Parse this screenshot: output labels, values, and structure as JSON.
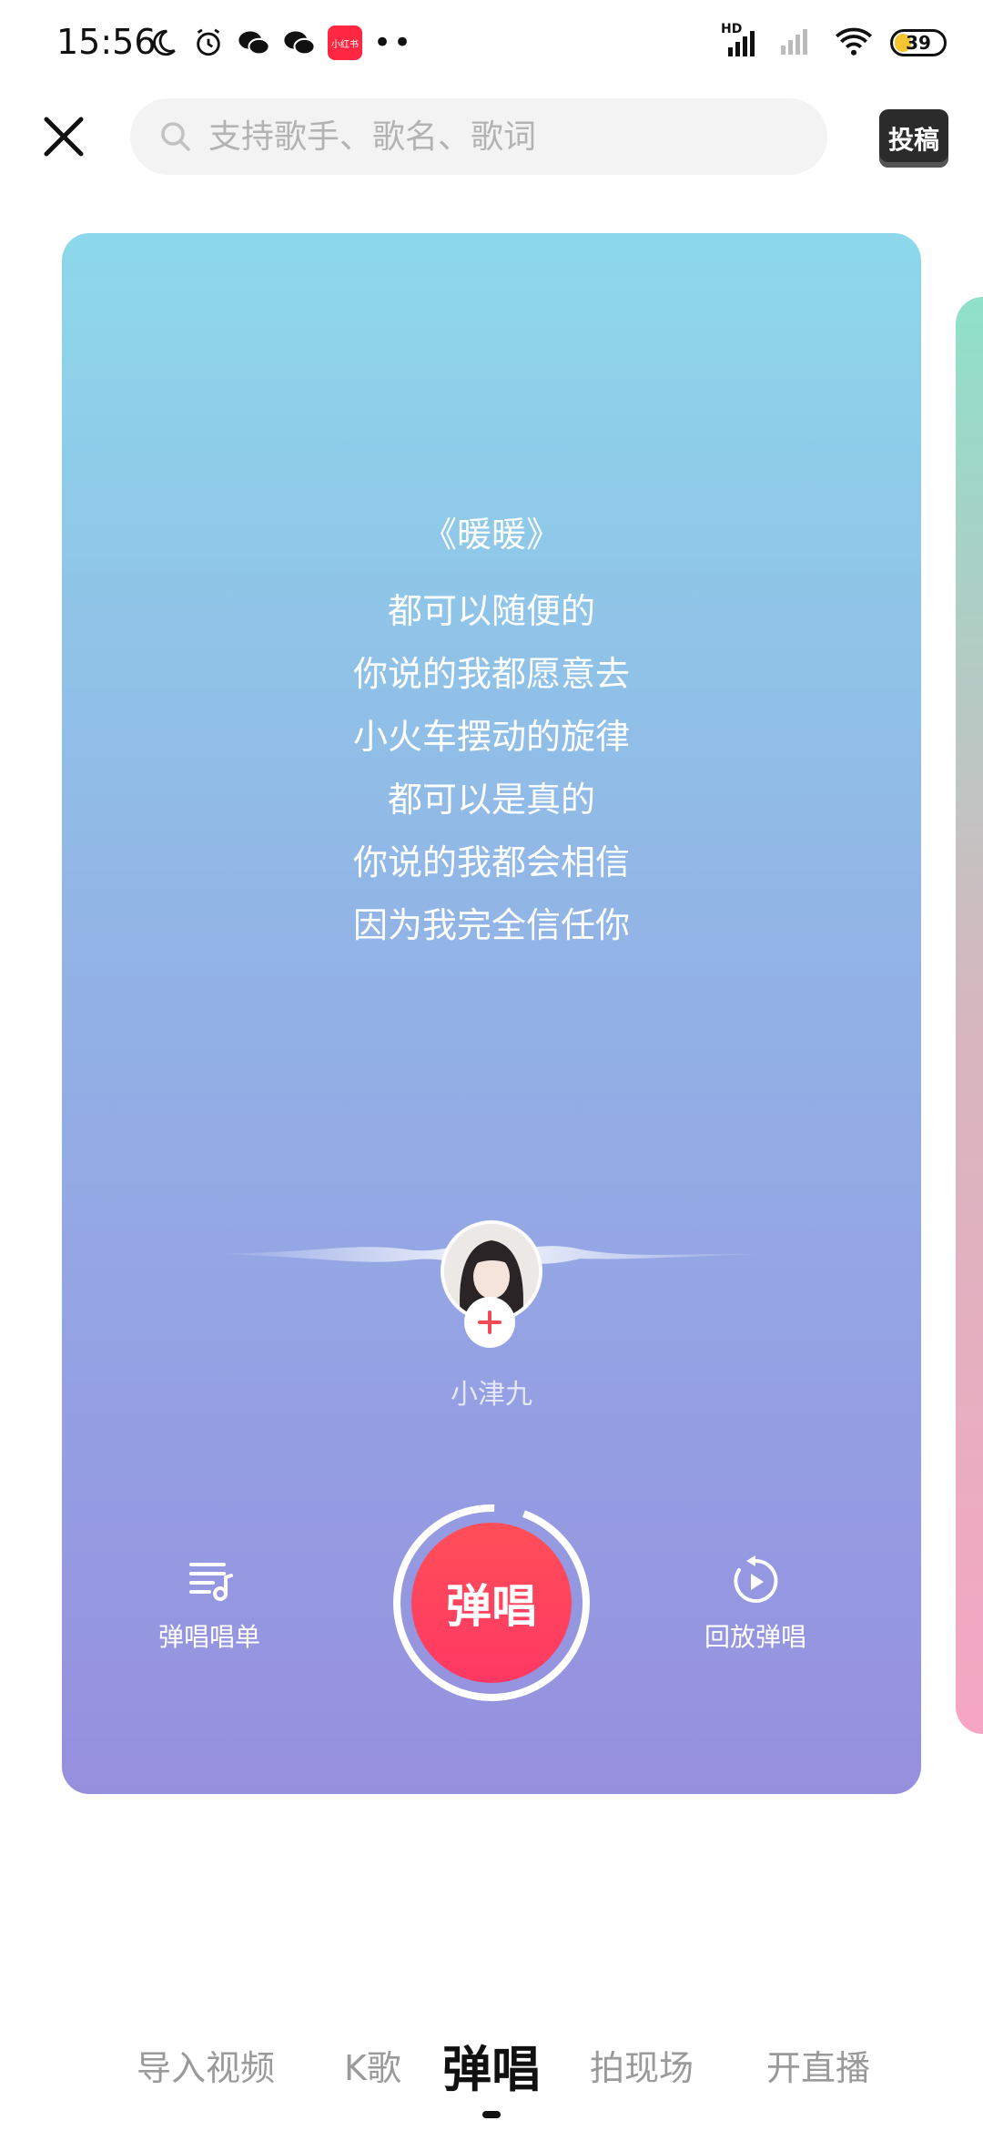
{
  "status_bar": {
    "time": "15:56",
    "app_badge": "小红书",
    "dots": "••",
    "network_label": "HD",
    "battery": "39"
  },
  "search": {
    "placeholder": "支持歌手、歌名、歌词"
  },
  "header": {
    "submit_label": "投稿"
  },
  "card": {
    "song_title": "《暖暖》",
    "lyrics": [
      "都可以随便的",
      "你说的我都愿意去",
      "小火车摆动的旋律",
      "都可以是真的",
      "你说的我都会相信",
      "因为我完全信任你"
    ],
    "username": "小津九",
    "left_tool_label": "弹唱唱单",
    "right_tool_label": "回放弹唱",
    "main_button_label": "弹唱"
  },
  "tabs": [
    {
      "label": "导入视频",
      "active": false
    },
    {
      "label": "K歌",
      "active": false
    },
    {
      "label": "弹唱",
      "active": true
    },
    {
      "label": "拍现场",
      "active": false
    },
    {
      "label": "开直播",
      "active": false
    }
  ],
  "colors": {
    "accent": "#ff3f5e",
    "card_top": "#8dd8ea",
    "card_bottom": "#968fde"
  }
}
